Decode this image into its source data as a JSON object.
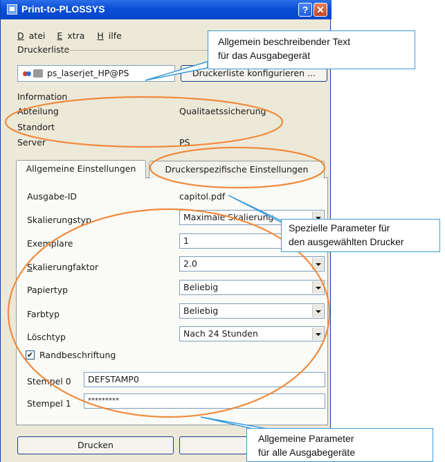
{
  "window": {
    "title": "Print-to-PLOSSYS"
  },
  "titlebar": {
    "help_glyph": "?",
    "close_glyph": "✕"
  },
  "menu": {
    "datei": {
      "accel": "D",
      "rest": "atei"
    },
    "extra": {
      "accel": "E",
      "rest": "xtra"
    },
    "hilfe": {
      "accel": "H",
      "rest": "ilfe"
    }
  },
  "printer_list": {
    "group_label": "Druckerliste",
    "selected": "ps_laserjet_HP@PS",
    "configure_button": "Druckerliste konfigurieren ..."
  },
  "info": {
    "heading": "Information",
    "rows": [
      {
        "label": "Abteilung",
        "value": "Qualitaetssicherung"
      },
      {
        "label": "Standort",
        "value": ""
      },
      {
        "label": "Server",
        "value": "PS"
      }
    ]
  },
  "tabs": [
    "Allgemeine Einstellungen",
    "Druckerspezifische Einstellungen"
  ],
  "settings": {
    "ausgabe_id": {
      "label": "Ausgabe-ID",
      "value": "capitol.pdf"
    },
    "skalierungstyp": {
      "label": "Skalierungstyp",
      "value": "Maximale Skalierung"
    },
    "exemplare": {
      "label": "Exemplare",
      "value": "1"
    },
    "skalierungfaktor": {
      "label": "Skalierungfaktor",
      "accel": "S",
      "rest": "kalierungfaktor",
      "value": "2.0"
    },
    "papiertyp": {
      "label": "Papiertyp",
      "value": "Beliebig"
    },
    "farbtyp": {
      "label": "Farbtyp",
      "value": "Beliebig"
    },
    "loeschtyp": {
      "label": "Löschtyp",
      "value": "Nach 24 Stunden"
    },
    "randbeschriftung": {
      "label": "Randbeschriftung",
      "checked": true,
      "check_glyph": "✔"
    },
    "stempel0": {
      "label": "Stempel 0",
      "value": "DEFSTAMP0"
    },
    "stempel1": {
      "label": "Stempel 1",
      "value": "*********"
    }
  },
  "buttons": {
    "print": "Drucken"
  },
  "callouts": {
    "top": [
      "Allgemein beschreibender Text",
      "für das Ausgabegerät"
    ],
    "middle": [
      "Spezielle Parameter für",
      "den ausgewählten Drucker"
    ],
    "bottom": [
      "Allgemeine Parameter",
      "für alle Ausgabegeräte"
    ]
  },
  "colors": {
    "title_bar": "#0a4fd8",
    "annotation_ellipse": "#f08a3c",
    "callout_border": "#3a9ad9"
  }
}
